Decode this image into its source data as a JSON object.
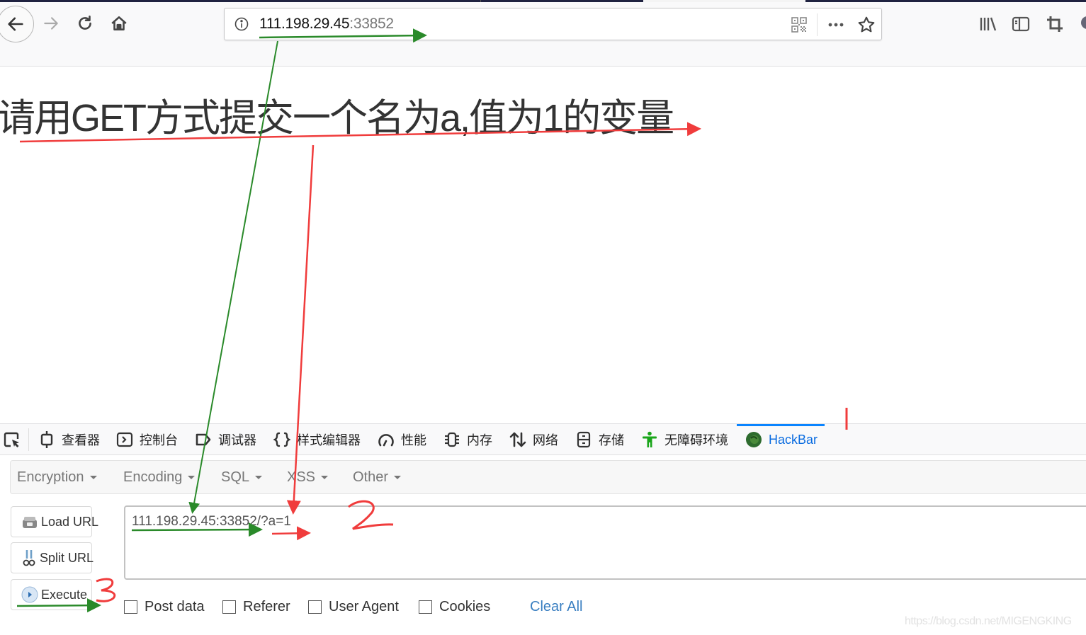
{
  "browser": {
    "url_host": "111.198.29.45",
    "url_port": ":33852",
    "icons": {
      "back": "arrow-left-icon",
      "forward": "arrow-right-icon",
      "reload": "reload-icon",
      "home": "home-icon",
      "site_info": "info-icon",
      "qr": "qr-code-icon",
      "page_actions": "more-icon",
      "bookmark": "star-icon",
      "library": "library-icon",
      "sidebar": "sidebar-icon",
      "screenshot": "crop-icon"
    }
  },
  "page": {
    "heading": "请用GET方式提交一个名为a,值为1的变量"
  },
  "devtools": {
    "tabs": [
      {
        "label": "查看器",
        "icon": "inspector-icon"
      },
      {
        "label": "控制台",
        "icon": "console-icon"
      },
      {
        "label": "调试器",
        "icon": "debugger-icon"
      },
      {
        "label": "样式编辑器",
        "icon": "style-editor-icon"
      },
      {
        "label": "性能",
        "icon": "performance-icon"
      },
      {
        "label": "内存",
        "icon": "memory-icon"
      },
      {
        "label": "网络",
        "icon": "network-icon"
      },
      {
        "label": "存储",
        "icon": "storage-icon"
      },
      {
        "label": "无障碍环境",
        "icon": "accessibility-icon"
      },
      {
        "label": "HackBar",
        "icon": "hackbar-icon",
        "active": true
      }
    ]
  },
  "hackbar": {
    "menu": [
      {
        "label": "Encryption"
      },
      {
        "label": "Encoding"
      },
      {
        "label": "SQL"
      },
      {
        "label": "XSS"
      },
      {
        "label": "Other"
      }
    ],
    "buttons": {
      "load_url": "Load URL",
      "split_url": "Split URL",
      "execute": "Execute"
    },
    "url_value": "111.198.29.45:33852/?a=1",
    "checkboxes": [
      {
        "label": "Post data",
        "checked": false
      },
      {
        "label": "Referer",
        "checked": false
      },
      {
        "label": "User Agent",
        "checked": false
      },
      {
        "label": "Cookies",
        "checked": false
      }
    ],
    "clear_all": "Clear All"
  },
  "annotations": {
    "step_labels": [
      "1",
      "2",
      "3"
    ],
    "colors": {
      "red": "#f03c3c",
      "green": "#2a8a2a"
    }
  },
  "watermark": "https://blog.csdn.net/MIGENGKING",
  "colors": {
    "accent_blue": "#0a84ff",
    "hackbar_active_text": "#0a6ce0",
    "link_blue": "#3a7fc1"
  }
}
